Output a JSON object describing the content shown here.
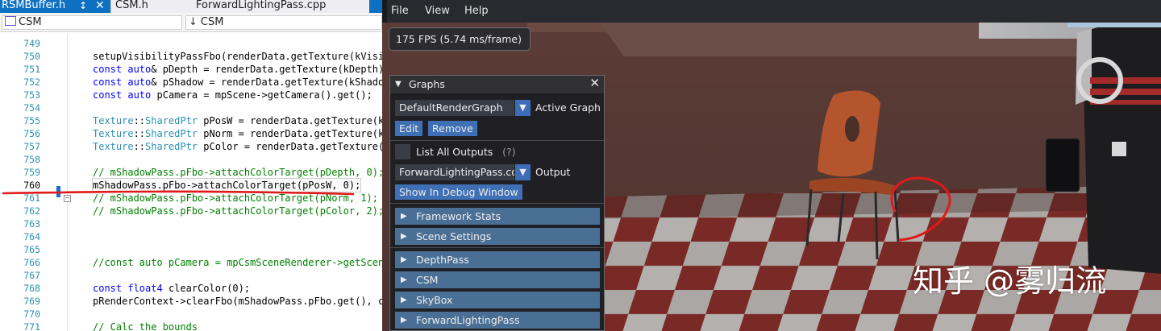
{
  "editor": {
    "tabs": [
      {
        "label": "RSMBuffer.h",
        "active": true
      },
      {
        "label": "CSM.h",
        "active": false
      },
      {
        "label": "ForwardLightingPass.cpp",
        "active": false
      }
    ],
    "tab_pin": "p",
    "tab_close": "✕",
    "scope_left": "CSM",
    "scope_right": "CSM",
    "lines": [
      {
        "num": "749",
        "html": ""
      },
      {
        "num": "750",
        "html": "    setupVisibilityPassFbo(renderData.getTexture(kVisibilit"
      },
      {
        "num": "751",
        "html": "    const auto& pDepth = renderData.getTexture(kDepth);"
      },
      {
        "num": "752",
        "html": "    const auto& pShadow = renderData.getTexture(kShadowMap)"
      },
      {
        "num": "753",
        "html": "    const auto pCamera = mpScene->getCamera().get();"
      },
      {
        "num": "754",
        "html": ""
      },
      {
        "num": "755",
        "html": "    Texture::SharedPtr pPosW = renderData.getTexture(kPosW)"
      },
      {
        "num": "756",
        "html": "    Texture::SharedPtr pNorm = renderData.getTexture(kNorm)"
      },
      {
        "num": "757",
        "html": "    Texture::SharedPtr pColor = renderData.getTexture(kColo"
      },
      {
        "num": "758",
        "html": ""
      },
      {
        "num": "759",
        "html": "    // mShadowPass.pFbo->attachColorTarget(pDepth, 0);"
      },
      {
        "num": "760",
        "html": "    mShadowPass.pFbo->attachColorTarget(pPosW, 0);"
      },
      {
        "num": "761",
        "html": "    // mShadowPass.pFbo->attachColorTarget(pNorm, 1);"
      },
      {
        "num": "762",
        "html": "    // mShadowPass.pFbo->attachColorTarget(pColor, 2);"
      },
      {
        "num": "763",
        "html": ""
      },
      {
        "num": "764",
        "html": ""
      },
      {
        "num": "765",
        "html": ""
      },
      {
        "num": "766",
        "html": "    //const auto pCamera = mpCsmSceneRenderer->getScene()->"
      },
      {
        "num": "767",
        "html": ""
      },
      {
        "num": "768",
        "html": "    const float4 clearColor(0);"
      },
      {
        "num": "769",
        "html": "    pRenderContext->clearFbo(mShadowPass.pFbo.get(), clearC"
      },
      {
        "num": "770",
        "html": ""
      },
      {
        "num": "771",
        "html": "    // Calc the bounds"
      }
    ]
  },
  "app": {
    "menu": [
      "File",
      "View",
      "Help"
    ],
    "fps": "175 FPS (5.74 ms/frame)",
    "graphs": {
      "title": "Graphs",
      "close": "✕",
      "render_graph_value": "DefaultRenderGraph",
      "render_graph_label": "Active Graph",
      "edit_label": "Edit",
      "remove_label": "Remove",
      "list_all_outputs_label": "List All Outputs",
      "help_mark": "(?)",
      "output_value": "ForwardLightingPass.co",
      "output_label": "Output",
      "debug_window_label": "Show In Debug Window",
      "sections": [
        "Framework Stats",
        "Scene Settings",
        "DepthPass",
        "CSM",
        "SkyBox",
        "ForwardLightingPass"
      ]
    },
    "watermark": "知乎 @雾归流"
  },
  "colors": {
    "accent_blue": "#3f6fb5",
    "header_blue": "#4a6f95",
    "annotation_red": "#e01a1a"
  }
}
